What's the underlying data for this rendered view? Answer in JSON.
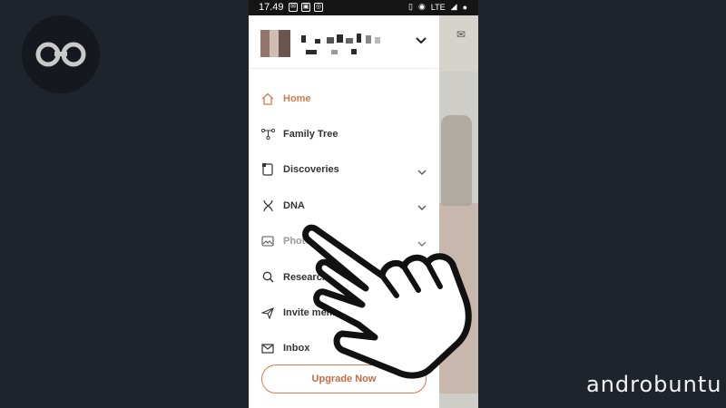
{
  "status_bar": {
    "time": "17.49",
    "network": "LTE"
  },
  "profile": {
    "chevron_icon": "chevron-down-icon"
  },
  "menu": [
    {
      "label": "Home",
      "icon": "home-icon",
      "active": true,
      "has_chevron": false
    },
    {
      "label": "Family Tree",
      "icon": "family-tree-icon",
      "active": false,
      "has_chevron": false
    },
    {
      "label": "Discoveries",
      "icon": "discoveries-icon",
      "active": false,
      "has_chevron": true
    },
    {
      "label": "DNA",
      "icon": "dna-icon",
      "active": false,
      "has_chevron": true
    },
    {
      "label": "Photos",
      "icon": "photos-icon",
      "active": false,
      "has_chevron": true
    },
    {
      "label": "Research",
      "icon": "search-icon",
      "active": false,
      "has_chevron": false
    },
    {
      "label": "Invite members",
      "icon": "send-icon",
      "active": false,
      "has_chevron": false
    },
    {
      "label": "Inbox",
      "icon": "mail-icon",
      "active": false,
      "has_chevron": false
    }
  ],
  "upgrade_button": "Upgrade Now",
  "watermark": "androbuntu",
  "colors": {
    "accent": "#d27a50",
    "background": "#1e242c",
    "status_bar": "#151515"
  }
}
